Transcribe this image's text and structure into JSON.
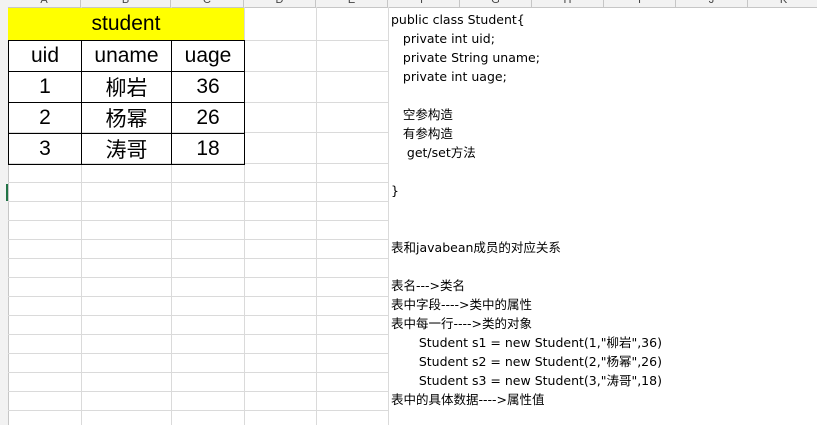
{
  "columns": [
    "A",
    "B",
    "C",
    "D",
    "E",
    "F",
    "G",
    "H",
    "I",
    "J",
    "K"
  ],
  "row_numbers": [
    "",
    "",
    "",
    "",
    "",
    "",
    "",
    "",
    "",
    "",
    "",
    "",
    "",
    "",
    "",
    "",
    "",
    "",
    "",
    "",
    ""
  ],
  "table": {
    "title": "student",
    "title_bg": "#ffff00",
    "headers": [
      "uid",
      "uname",
      "uage"
    ],
    "rows": [
      [
        "1",
        "柳岩",
        "36"
      ],
      [
        "2",
        "杨幂",
        "26"
      ],
      [
        "3",
        "涛哥",
        "18"
      ]
    ]
  },
  "notes": {
    "lines": [
      "public class Student{",
      "   private int uid;",
      "   private String uname;",
      "   private int uage;",
      "",
      "   空参构造",
      "   有参构造",
      "    get/set方法",
      "",
      "}",
      "",
      "",
      "表和javabean成员的对应关系",
      "",
      "表名--->类名",
      "表中字段---->类中的属性",
      "表中每一行---->类的对象",
      "       Student s1 = new Student(1,\"柳岩\",36)",
      "       Student s2 = new Student(2,\"杨幂\",26)",
      "       Student s3 = new Student(3,\"涛哥\",18)",
      "表中的具体数据---->属性值"
    ]
  }
}
